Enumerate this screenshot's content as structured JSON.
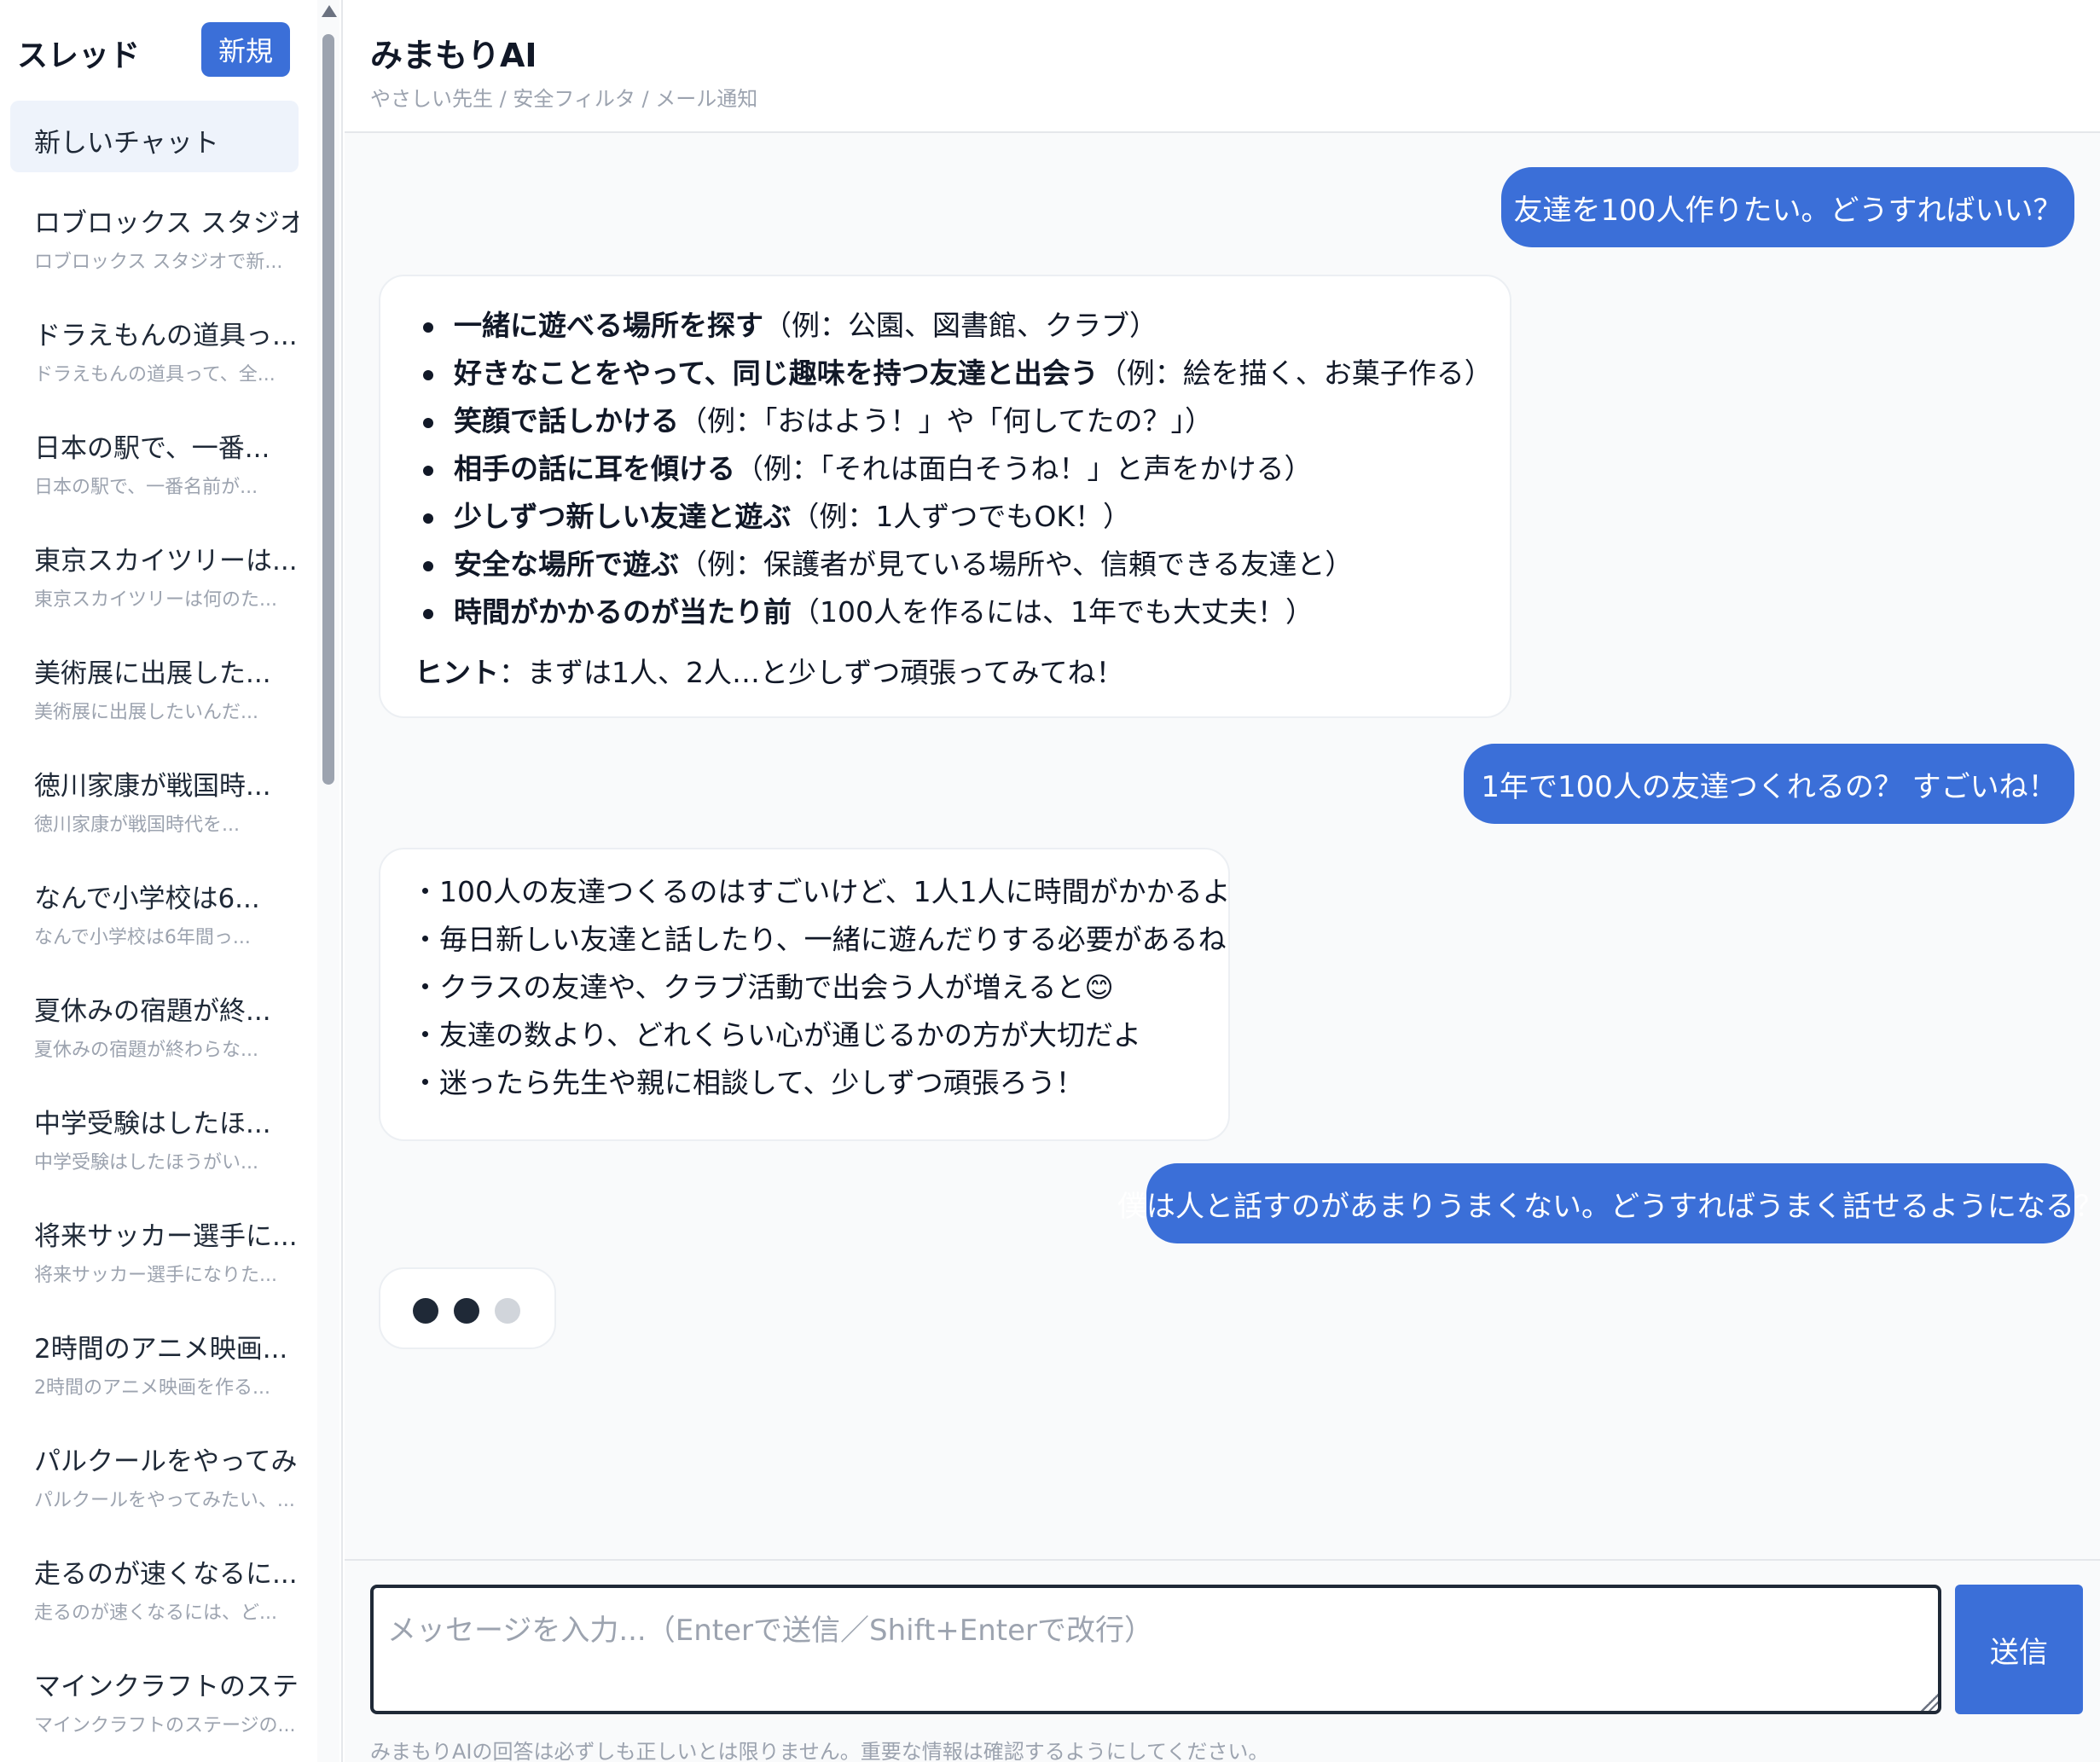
{
  "sidebar": {
    "title": "スレッド",
    "new_label": "新規",
    "active_item": "新しいチャット",
    "threads": [
      {
        "title": "ロブロックス スタジオ...",
        "sub": "ロブロックス スタジオで新..."
      },
      {
        "title": "ドラえもんの道具っ...",
        "sub": "ドラえもんの道具って、全..."
      },
      {
        "title": "日本の駅で、一番...",
        "sub": "日本の駅で、一番名前が..."
      },
      {
        "title": "東京スカイツリーは...",
        "sub": "東京スカイツリーは何のた..."
      },
      {
        "title": "美術展に出展した...",
        "sub": "美術展に出展したいんだ..."
      },
      {
        "title": "徳川家康が戦国時...",
        "sub": "徳川家康が戦国時代を..."
      },
      {
        "title": "なんで小学校は6...",
        "sub": "なんで小学校は6年間っ..."
      },
      {
        "title": "夏休みの宿題が終...",
        "sub": "夏休みの宿題が終わらな..."
      },
      {
        "title": "中学受験はしたほ...",
        "sub": "中学受験はしたほうがい..."
      },
      {
        "title": "将来サッカー選手に...",
        "sub": "将来サッカー選手になりた..."
      },
      {
        "title": "2時間のアニメ映画...",
        "sub": "2時間のアニメ映画を作る..."
      },
      {
        "title": "パルクールをやってみ...",
        "sub": "パルクールをやってみたい、..."
      },
      {
        "title": "走るのが速くなるに...",
        "sub": "走るのが速くなるには、ど..."
      },
      {
        "title": "マインクラフトのステ...",
        "sub": "マインクラフトのステージの..."
      }
    ]
  },
  "header": {
    "title": "みまもりAI",
    "subtitle": "やさしい先生 / 安全フィルタ / メール通知"
  },
  "messages": {
    "user1": "友達を100人作りたい。どうすればいい？",
    "ai1": {
      "items": [
        {
          "bold": "一緒に遊べる場所を探す",
          "rest": "（例：公園、図書館、クラブ）"
        },
        {
          "bold": "好きなことをやって、同じ趣味を持つ友達と出会う",
          "rest": "（例：絵を描く、お菓子作る）"
        },
        {
          "bold": "笑顔で話しかける",
          "rest": "（例：「おはよう！」や「何してたの？」）"
        },
        {
          "bold": "相手の話に耳を傾ける",
          "rest": "（例：「それは面白そうね！」と声をかける）"
        },
        {
          "bold": "少しずつ新しい友達と遊ぶ",
          "rest": "（例：1人ずつでもOK！）"
        },
        {
          "bold": "安全な場所で遊ぶ",
          "rest": "（例：保護者が見ている場所や、信頼できる友達と）"
        },
        {
          "bold": "時間がかかるのが当たり前",
          "rest": "（100人を作るには、1年でも大丈夫！）"
        }
      ],
      "hint_bold": "ヒント",
      "hint_rest": "：まずは1人、2人…と少しずつ頑張ってみてね！"
    },
    "user2": "1年で100人の友達つくれるの？ すごいね！",
    "ai2": {
      "lines": [
        "・100人の友達つくるのはすごいけど、1人1人に時間がかかるよ",
        "・毎日新しい友達と話したり、一緒に遊んだりする必要があるね",
        "・クラスの友達や、クラブ活動で出会う人が増えると😊",
        "・友達の数より、どれくらい心が通じるかの方が大切だよ",
        "・迷ったら先生や親に相談して、少しずつ頑張ろう！"
      ]
    },
    "user3": "僕は人と話すのがあまりうまくない。どうすればうまく話せるようになる？"
  },
  "input": {
    "placeholder": "メッセージを入力...（Enterで送信／Shift+Enterで改行）",
    "send_label": "送信",
    "disclaimer": "みまもりAIの回答は必ずしも正しいとは限りません。重要な情報は確認するようにしてください。"
  },
  "colors": {
    "accent": "#3b6fd8",
    "typing_dot_dark": "#1f2937",
    "typing_dot_light": "#d1d5db"
  }
}
